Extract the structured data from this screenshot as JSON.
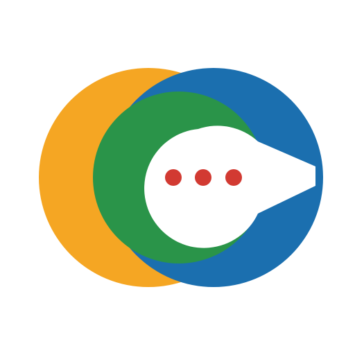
{
  "logo": {
    "icon": "chat-bubble-logo-icon",
    "colors": {
      "background": "#ffffff",
      "orange": "#f5a623",
      "green": "#2a9449",
      "blue": "#1b6faf",
      "dot": "#d23a32"
    },
    "dot_count": 3
  }
}
